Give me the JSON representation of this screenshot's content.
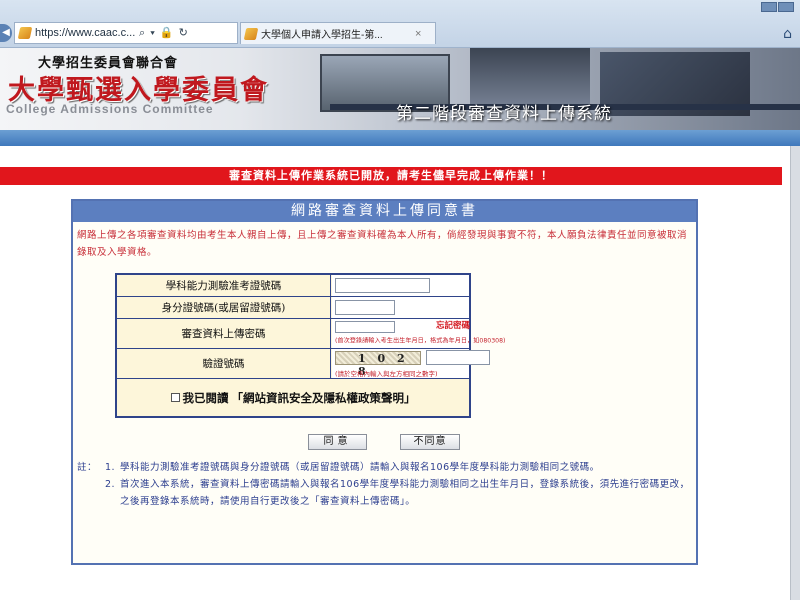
{
  "browser": {
    "address": "https://www.caac.c...",
    "address_tools": "⌕ ▾ 🔒 ↻",
    "tab_title": "大學個人申請入學招生-第...",
    "tab_close": "×",
    "back_glyph": "◀",
    "home_glyph": "⌂"
  },
  "banner": {
    "org": "大學招生委員會聯合會",
    "title": "大學甄選入學委員會",
    "subtitle": "College Admissions Committee",
    "system_name": "第二階段審查資料上傳系統"
  },
  "notice": "審查資料上傳作業系統已開放，請考生儘早完成上傳作業！！",
  "panel": {
    "title": "網路審查資料上傳同意書",
    "agreement": "網路上傳之各項審查資料均由考生本人親自上傳，且上傳之審查資料確為本人所有，倘經發現與事實不符，本人願負法律責任並同意被取消錄取及入學資格。"
  },
  "form": {
    "exam_id_label": "學科能力測驗准考證號碼",
    "exam_id_value": "",
    "national_id_label": "身分證號碼(或居留證號碼)",
    "national_id_value": "",
    "password_label": "審查資料上傳密碼",
    "password_value": "",
    "forgot_link": "忘記密碼",
    "password_hint": "(首次登錄請輸入考生出生年月日，格式為年月日，如080308)",
    "captcha_label": "驗證號碼",
    "captcha_code": "1 0 2 8",
    "captcha_value": "",
    "captcha_hint": "(請於空格內輸入與左方相同之數字)",
    "consent_prefix": "我已閱讀",
    "consent_link": "「網站資訊安全及隱私權政策聲明」"
  },
  "buttons": {
    "agree": "同意",
    "disagree": "不同意"
  },
  "notes": {
    "lead": "註：",
    "items": [
      {
        "num": "1.",
        "text": "學科能力測驗准考證號碼與身分證號碼（或居留證號碼）請輸入與報名106學年度學科能力測驗相同之號碼。"
      },
      {
        "num": "2.",
        "text": "首次進入本系統，審查資料上傳密碼請輸入與報名106學年度學科能力測驗相同之出生年月日，登錄系統後，須先進行密碼更改，之後再登錄本系統時，請使用自行更改後之「審查資料上傳密碼」。"
      }
    ]
  },
  "colors": {
    "notice_red": "#e1161c",
    "panel_blue": "#5c7fc0",
    "banner_title_red": "#c0181e",
    "note_blue": "#2d3f8f"
  }
}
